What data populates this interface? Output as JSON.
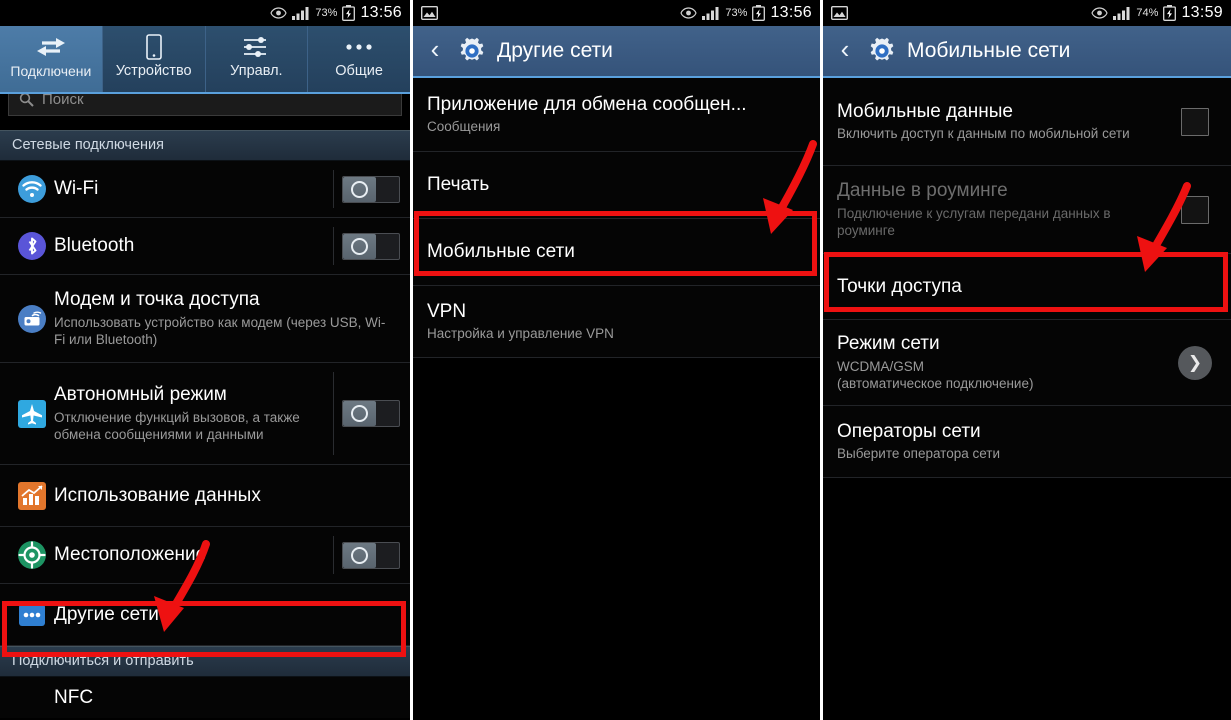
{
  "panels": [
    {
      "id": "connections",
      "statusbar": {
        "eye_icon": "eye-icon",
        "signal_icon": "signal-bars-icon",
        "battery_pct": "73%",
        "battery_icon": "battery-charging-icon",
        "clock": "13:56"
      },
      "tabs": [
        {
          "label": "Подключени",
          "icon": "connections-arrows-icon",
          "active": true
        },
        {
          "label": "Устройство",
          "icon": "device-phone-icon",
          "active": false
        },
        {
          "label": "Управл.",
          "icon": "sliders-icon",
          "active": false
        },
        {
          "label": "Общие",
          "icon": "dots-three-icon",
          "active": false
        }
      ],
      "search": {
        "placeholder": "Поиск",
        "icon": "search-icon"
      },
      "section_headers": {
        "network": "Сетевые подключения",
        "connect_send": "Подключиться и отправить"
      },
      "rows": [
        {
          "icon": "wifi-icon",
          "title": "Wi-Fi",
          "sub": "",
          "control": "toggle"
        },
        {
          "icon": "bluetooth-icon",
          "title": "Bluetooth",
          "sub": "",
          "control": "toggle"
        },
        {
          "icon": "tethering-hotspot-icon",
          "title": "Модем и точка доступа",
          "sub": "Использовать устройство как модем (через USB, Wi-Fi или Bluetooth)",
          "control": "none"
        },
        {
          "icon": "airplane-icon",
          "title": "Автономный режим",
          "sub": "Отключение функций вызовов, а также обмена сообщениями и данными",
          "control": "toggle"
        },
        {
          "icon": "data-usage-icon",
          "title": "Использование данных",
          "sub": "",
          "control": "none"
        },
        {
          "icon": "location-icon",
          "title": "Местоположение",
          "sub": "",
          "control": "toggle"
        },
        {
          "icon": "more-networks-icon",
          "title": "Другие сети",
          "sub": "",
          "control": "none",
          "highlighted": true
        }
      ],
      "bottom_row": {
        "title": "NFC",
        "icon": "nfc-icon"
      }
    },
    {
      "id": "more-networks",
      "statusbar": {
        "picture_icon": "image-icon",
        "eye_icon": "eye-icon",
        "signal_icon": "signal-bars-icon",
        "battery_pct": "73%",
        "battery_icon": "battery-charging-icon",
        "clock": "13:56"
      },
      "actionbar": {
        "back_icon": "back-chevron-icon",
        "app_icon": "settings-gear-icon",
        "title": "Другие сети"
      },
      "rows": [
        {
          "title": "Приложение для обмена сообщен...",
          "sub": "Сообщения",
          "control": "none"
        },
        {
          "title": "Печать",
          "sub": "",
          "control": "none"
        },
        {
          "title": "Мобильные сети",
          "sub": "",
          "control": "none",
          "highlighted": true
        },
        {
          "title": "VPN",
          "sub": "Настройка и управление VPN",
          "control": "none"
        }
      ]
    },
    {
      "id": "mobile-networks",
      "statusbar": {
        "picture_icon": "image-icon",
        "eye_icon": "eye-icon",
        "signal_icon": "signal-bars-icon",
        "battery_pct": "74%",
        "battery_icon": "battery-charging-icon",
        "clock": "13:59"
      },
      "actionbar": {
        "back_icon": "back-chevron-icon",
        "app_icon": "settings-gear-icon",
        "title": "Мобильные сети"
      },
      "rows": [
        {
          "title": "Мобильные данные",
          "sub": "Включить доступ к данным по мобильной сети",
          "control": "checkbox",
          "disabled": false
        },
        {
          "title": "Данные в роуминге",
          "sub": "Подключение к услугам передани данных в роуминге",
          "control": "checkbox",
          "disabled": true
        },
        {
          "title": "Точки доступа",
          "sub": "",
          "control": "none",
          "highlighted": true
        },
        {
          "title": "Режим сети",
          "sub": "WCDMA/GSM\n(автоматическое подключение)",
          "control": "chevron"
        },
        {
          "title": "Операторы сети",
          "sub": "Выберите оператора сети",
          "control": "none"
        }
      ]
    }
  ],
  "annotation": {
    "color": "#ee1111",
    "arrow_icon": "red-arrow-annotation",
    "box_icon": "red-highlight-box"
  }
}
